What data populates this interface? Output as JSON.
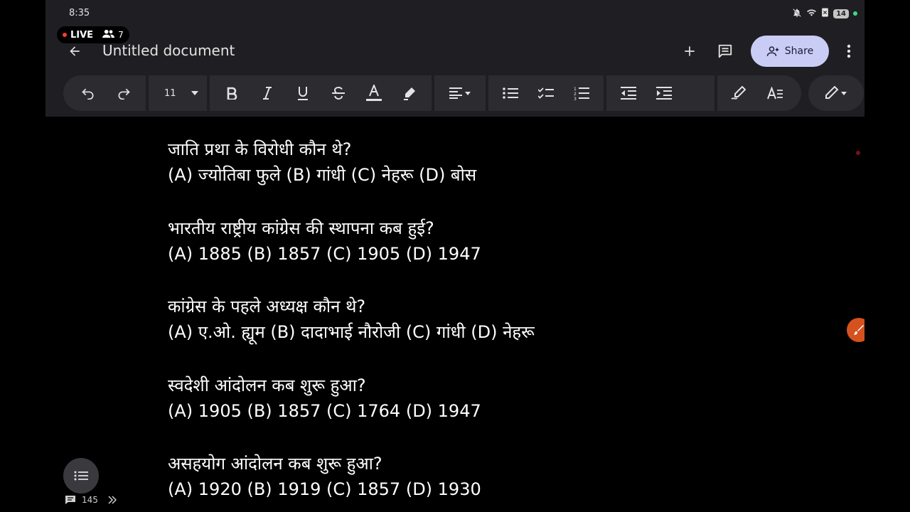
{
  "status_bar": {
    "time": "8:35",
    "battery": "14"
  },
  "live": {
    "label": "LIVE",
    "viewers": "7"
  },
  "document": {
    "title": "Untitled document"
  },
  "actions": {
    "share_label": "Share"
  },
  "toolbar": {
    "font_size": "11"
  },
  "questions": [
    {
      "q": "जाति प्रथा के विरोधी कौन थे?",
      "options": "(A) ज्योतिबा फुले (B) गांधी (C) नेहरू (D) बोस"
    },
    {
      "q": "भारतीय राष्ट्रीय कांग्रेस की स्थापना कब हुई?",
      "options": "(A) 1885 (B) 1857 (C) 1905 (D) 1947"
    },
    {
      "q": "कांग्रेस के पहले अध्यक्ष कौन थे?",
      "options": "(A) ए.ओ. ह्यूम (B) दादाभाई नौरोजी (C) गांधी (D) नेहरू"
    },
    {
      "q": "स्वदेशी आंदोलन कब शुरू हुआ?",
      "options": "(A) 1905 (B) 1857 (C) 1764 (D) 1947"
    },
    {
      "q": "असहयोग आंदोलन कब शुरू हुआ?",
      "options": "(A) 1920 (B) 1919 (C) 1857 (D) 1930"
    }
  ],
  "comments": {
    "count": "145"
  },
  "colors": {
    "accent_share": "#c9cdf6",
    "toolbar_bg": "#1f1f23",
    "fab": "#d5521f",
    "live_dot": "#ff3b30"
  }
}
